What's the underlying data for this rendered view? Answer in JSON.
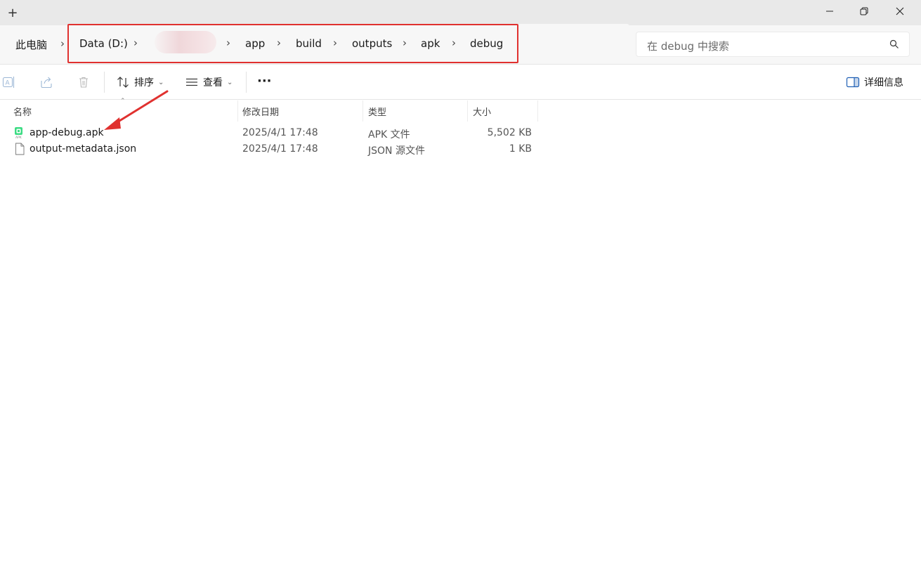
{
  "window": {
    "new_tab": "+",
    "minimize": "—",
    "maximize": "▢",
    "close": "✕"
  },
  "breadcrumb": {
    "root": "此电脑",
    "items": [
      "Data (D:)",
      "app",
      "build",
      "outputs",
      "apk",
      "debug"
    ]
  },
  "search": {
    "placeholder": "在 debug 中搜索"
  },
  "toolbar": {
    "sort_label": "排序",
    "view_label": "查看",
    "more_label": "···",
    "details_label": "详细信息"
  },
  "columns": {
    "name": "名称",
    "modified": "修改日期",
    "type": "类型",
    "size": "大小"
  },
  "files": [
    {
      "name": "app-debug.apk",
      "modified": "2025/4/1 17:48",
      "type": "APK 文件",
      "size": "5,502 KB",
      "icon": "apk-file-icon"
    },
    {
      "name": "output-metadata.json",
      "modified": "2025/4/1 17:48",
      "type": "JSON 源文件",
      "size": "1 KB",
      "icon": "document-file-icon"
    }
  ],
  "colors": {
    "highlight": "#e0312f",
    "apk_icon": "#3ddc84"
  }
}
